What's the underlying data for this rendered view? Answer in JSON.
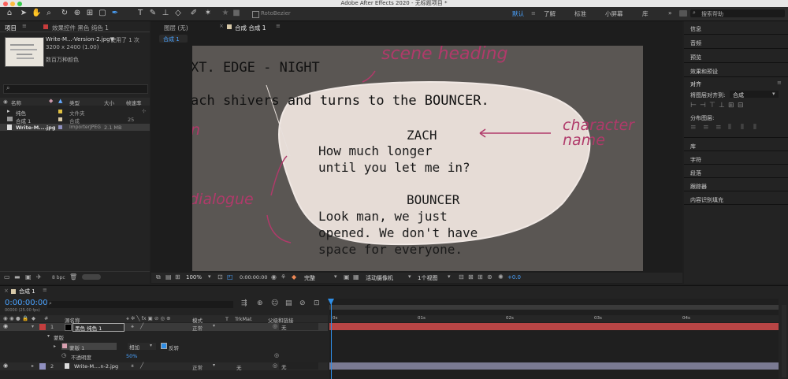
{
  "window": {
    "title": "Adobe After Effects 2020 - 无标题项目 *"
  },
  "toolbar": {
    "rotobezier_label": "RotoBezier",
    "workspaces": [
      "默认",
      "了解",
      "标准",
      "小屏幕",
      "库"
    ],
    "search_placeholder": "搜索帮助"
  },
  "project_panel": {
    "tab_label": "项目",
    "effects_tab_label": "效果控件 黑色 纯色 1",
    "selected_file": "Write-M...-Version-2.jpg▼",
    "usage": "使用了 1 次",
    "dimensions": "3200 x 2400 (1.00)",
    "color_info": "数百万种颜色",
    "search_value": "",
    "columns": [
      "名称",
      "类型",
      "大小",
      "帧速率"
    ],
    "items": [
      {
        "name": "纯色",
        "type": "文件夹",
        "size": "",
        "color": "#e0c040"
      },
      {
        "name": "合成 1",
        "type": "合成",
        "size": "25",
        "color": "#d8c9a8"
      },
      {
        "name": "Write-M....jpg",
        "type": "ImporterJPEG",
        "size": "2.1 MB",
        "color": "#9090c0"
      }
    ],
    "bpc": "8 bpc"
  },
  "viewer": {
    "layer_tab": "图层 (无)",
    "comp_tab": "合成 合成 1",
    "comp_sub_tab": "合成 1",
    "zoom": "100%",
    "timecode": "0:00:00:00",
    "quality": "完整",
    "camera": "活动摄像机",
    "views": "1个视图",
    "exposure": "+0.0"
  },
  "image": {
    "annotation_scene": "scene heading",
    "annotation_character": "character name",
    "annotation_dialogue": "dialogue",
    "annotation_left": "n",
    "line_scene": "XT. EDGE - NIGHT",
    "line_action": "ach shivers and turns to the BOUNCER.",
    "char1": "ZACH",
    "dlg1_a": "How much longer",
    "dlg1_b": "until you let me in?",
    "char2": "BOUNCER",
    "dlg2_a": "Look man, we just",
    "dlg2_b": "opened. We don't have",
    "dlg2_c": "space for everyone."
  },
  "right_panel": {
    "items_top": [
      "信息",
      "音频",
      "预览",
      "效果和预设"
    ],
    "align_title": "对齐",
    "align_to_label": "将图层对齐到:",
    "align_to_value": "合成",
    "distribute_label": "分布图层:",
    "items_bottom": [
      "库",
      "字符",
      "段落",
      "跟踪器",
      "内容识别填充"
    ]
  },
  "timeline": {
    "tab_label": "合成 1",
    "timecode": "0:00:00:00",
    "fps": "00000 (25.00 fps)",
    "col_source": "源名称",
    "col_mode": "模式",
    "col_t": "T",
    "col_trkmat": "TrkMat",
    "col_parent": "父级和链接",
    "ruler": [
      "0s",
      "01s",
      "02s",
      "03s",
      "04s"
    ],
    "layer1": {
      "num": "1",
      "name": "黑色 纯色 1",
      "mode": "正常",
      "parent": "无"
    },
    "mask_group": "蒙版",
    "mask1": {
      "name": "蒙版 1",
      "mode": "相加",
      "invert": "反转"
    },
    "opacity": {
      "label": "不透明度",
      "value": "50%"
    },
    "layer2": {
      "num": "2",
      "name": "Write-M....n-2.jpg",
      "mode": "正常",
      "trkmat": "无",
      "parent": "无"
    }
  },
  "colors": {
    "accent_blue": "#2f8ee6",
    "layer1_bar": "#b84545",
    "layer2_bar": "#7a7a92",
    "annotation": "#b03a6a"
  }
}
